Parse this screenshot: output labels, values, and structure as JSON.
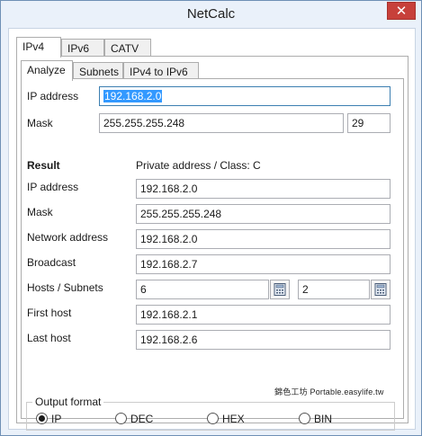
{
  "window": {
    "title": "NetCalc",
    "close_glyph": "✕"
  },
  "tabs_outer": [
    "IPv4",
    "IPv6",
    "CATV"
  ],
  "tabs_inner": [
    "Analyze",
    "Subnets",
    "IPv4 to IPv6"
  ],
  "input": {
    "ip_label": "IP address",
    "ip_value": "192.168.2.0",
    "mask_label": "Mask",
    "mask_value": "255.255.255.248",
    "prefix_value": "29"
  },
  "result": {
    "heading": "Result",
    "summary": "Private address / Class: C",
    "rows": [
      {
        "label": "IP address",
        "value": "192.168.2.0"
      },
      {
        "label": "Mask",
        "value": "255.255.255.248"
      },
      {
        "label": "Network address",
        "value": "192.168.2.0"
      },
      {
        "label": "Broadcast",
        "value": "192.168.2.7"
      }
    ],
    "hosts_label": "Hosts / Subnets",
    "hosts_value": "6",
    "subnets_value": "2",
    "first_host_label": "First host",
    "first_host_value": "192.168.2.1",
    "last_host_label": "Last host",
    "last_host_value": "192.168.2.6"
  },
  "output_format": {
    "title": "Output format",
    "options": [
      "IP",
      "DEC",
      "HEX",
      "BIN"
    ],
    "selected": "IP"
  },
  "watermark": "錦色工坊 Portable.easylife.tw",
  "icons": {
    "calculator": "calculator-icon"
  }
}
